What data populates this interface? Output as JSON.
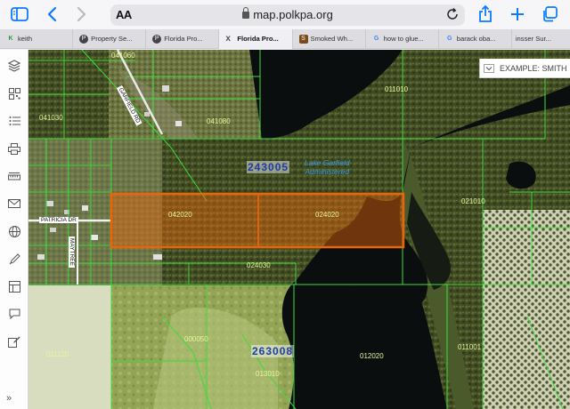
{
  "browser": {
    "address_aa": "AA",
    "url": "map.polkpa.org",
    "tabs": [
      {
        "label": "keith",
        "favicon": "K",
        "active": false
      },
      {
        "label": "Property Se...",
        "favicon": "P",
        "active": false
      },
      {
        "label": "Florida Pro...",
        "favicon": "P",
        "active": false
      },
      {
        "label": "Florida Pro...",
        "favicon": "x",
        "active": true
      },
      {
        "label": "Smoked Wh...",
        "favicon": "S",
        "active": false
      },
      {
        "label": "how to glue...",
        "favicon": "G",
        "active": false
      },
      {
        "label": "barack oba...",
        "favicon": "G",
        "active": false
      },
      {
        "label": "insser Sur...",
        "favicon": "",
        "active": false
      }
    ],
    "accent": "#0a7aff"
  },
  "rail": {
    "icons": [
      "layers-icon",
      "qr-grid-icon",
      "list-icon",
      "print-icon",
      "measure-icon",
      "mail-icon",
      "globe-icon",
      "pencil-icon",
      "table-icon",
      "comment-icon",
      "edit-form-icon"
    ],
    "expand_label": "»"
  },
  "map": {
    "search_placeholder": "EXAMPLE: SMITH",
    "parcel_labels": [
      "041060",
      "041080",
      "041030",
      "011010",
      "042020",
      "024020",
      "024030",
      "021010",
      "000050",
      "011120",
      "012020",
      "011001",
      "013010"
    ],
    "section_labels": [
      "243005",
      "263008"
    ],
    "water_label": "Lake Garfield\nAdministered",
    "road_labels": [
      "PATRICIA DR",
      "GARFIELD RD",
      "MAYTREE"
    ],
    "highlight_color": "#e8650a",
    "parcel_line_color": "#3cdc3c"
  }
}
